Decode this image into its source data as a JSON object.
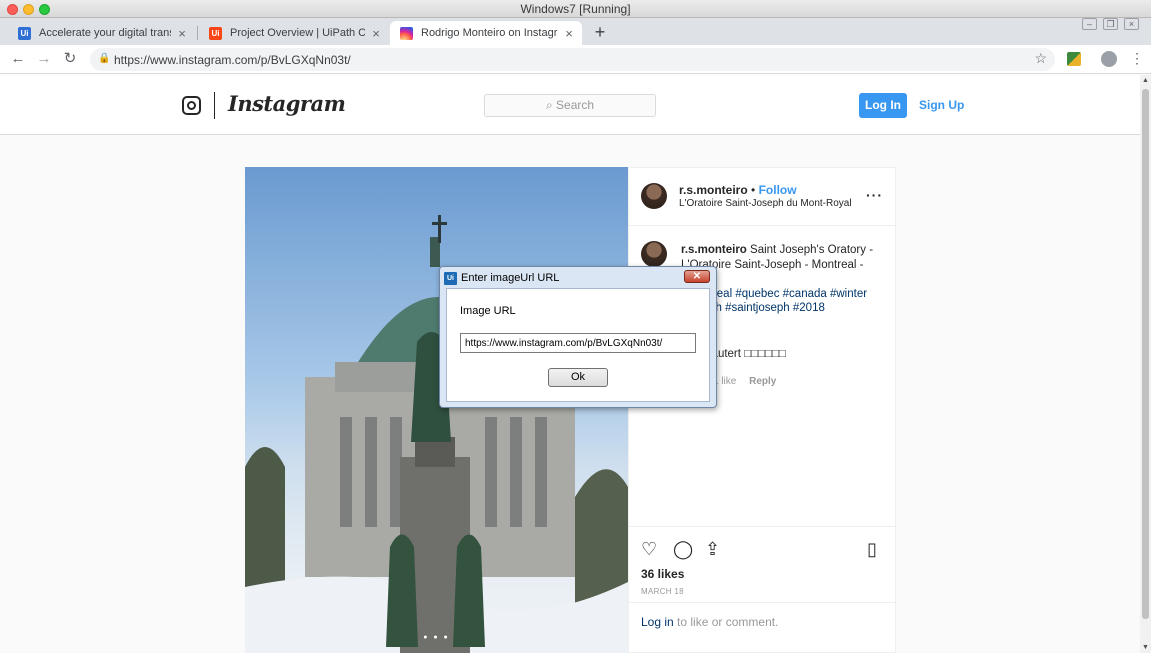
{
  "vm_window": {
    "title": "Windows7 [Running]"
  },
  "browser": {
    "tabs": [
      {
        "label": "Accelerate your digital transform",
        "icon": "uipath-icon",
        "active": false
      },
      {
        "label": "Project Overview | UiPath Conne",
        "icon": "uipath-icon",
        "active": false
      },
      {
        "label": "Rodrigo Monteiro on Instagram",
        "icon": "instagram-icon",
        "active": true
      }
    ],
    "url": "https://www.instagram.com/p/BvLGXqNn03t/"
  },
  "instagram": {
    "wordmark": "Instagram",
    "search_placeholder": "Search",
    "login_label": "Log In",
    "signup_label": "Sign Up",
    "post": {
      "username": "r.s.monteiro",
      "follow_separator": "•",
      "follow_label": "Follow",
      "location": "L'Oratoire Saint-Joseph du Mont-Royal",
      "caption_user": "r.s.monteiro",
      "caption_text": "Saint Joseph's Oratory - L'Oratoire Saint-Joseph - Montreal - 2018",
      "caption_tags": "#montreal #quebec #canada #winter #church #saintjoseph #2018",
      "comment_text": "lautert □□□□□□",
      "comment_likes": "1 like",
      "comment_reply": "Reply",
      "likes": "36 likes",
      "date": "MARCH 18",
      "login_link": "Log in",
      "login_rest": " to like or comment."
    }
  },
  "dialog": {
    "title": "Enter imageUrl URL",
    "label": "Image URL",
    "input_value": "https://www.instagram.com/p/BvLGXqNn03t/",
    "ok_label": "Ok",
    "close_glyph": "✕"
  }
}
